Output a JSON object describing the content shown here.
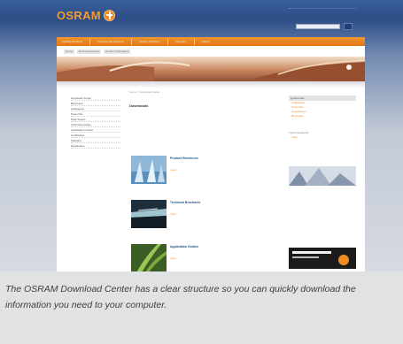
{
  "header": {
    "logo_text": "OSRAM",
    "logo_icon": "osram-bulb-logo",
    "search_placeholder": ""
  },
  "nav": {
    "items": [
      "Lighting Products",
      "Professional Solutions",
      "Industry Solutions",
      "Company",
      "Career"
    ]
  },
  "breadcrumb": [
    "Home",
    "Download Center",
    "Product Information"
  ],
  "sidebar": {
    "items": [
      "Download Center",
      "Brochures",
      "Catalogues",
      "Press Kits",
      "Data Sheets",
      "Technical Guides",
      "Application Guides",
      "Certificates",
      "Software",
      "Newsletters"
    ]
  },
  "main": {
    "breadcrumb": "Home > Download Center",
    "title": "Downloads",
    "intro": "",
    "items": [
      {
        "title": "Product Brochures",
        "desc": "",
        "link": "more"
      },
      {
        "title": "Technical Brochures",
        "desc": "",
        "link": "more"
      },
      {
        "title": "Application Guides",
        "desc": "",
        "link": "more"
      }
    ]
  },
  "right": {
    "box_title": "Quick Links",
    "links": [
      "Catalogues",
      "Press Kits",
      "Data Sheets",
      "Brochures"
    ],
    "teaser_titles": [
      "Latest Newsletter",
      "Download Center",
      "Software Download"
    ],
    "teaser_links": [
      "more",
      "more"
    ]
  },
  "caption": {
    "text": "The OSRAM Download Center has a clear structure so you can quickly download the information you need to your computer."
  },
  "colors": {
    "brand_orange": "#f28b20",
    "header_blue": "#2c4d86",
    "caption_bg": "#e1e2e4"
  }
}
